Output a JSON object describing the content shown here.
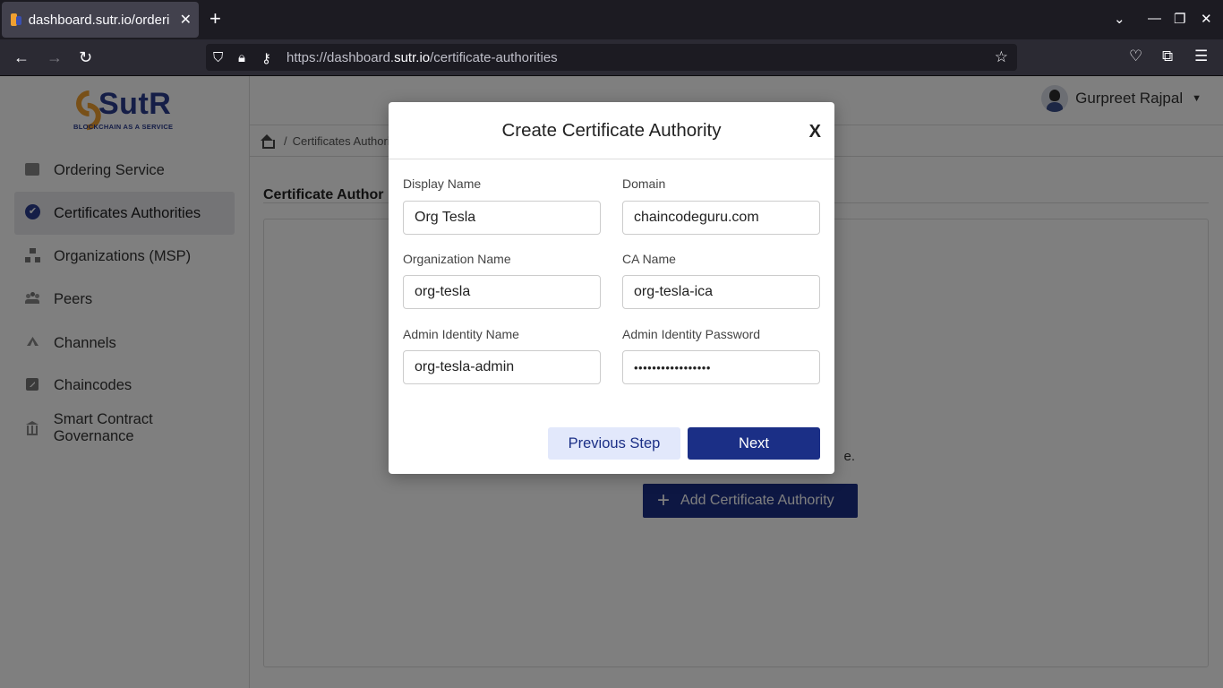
{
  "browser": {
    "tab_title": "dashboard.sutr.io/orderi",
    "tab_close": "✕",
    "new_tab": "+",
    "url_prefix": "https://dashboard.",
    "url_host": "sutr.io",
    "url_path": "/certificate-authorities"
  },
  "sidebar": {
    "logo_text": "SutR",
    "logo_tagline": "BLOCKCHAIN AS A SERVICE",
    "items": [
      {
        "label": "Ordering Service",
        "icon": "box-icon"
      },
      {
        "label": "Certificates Authorities",
        "icon": "verified-icon",
        "active": true
      },
      {
        "label": "Organizations (MSP)",
        "icon": "org-icon"
      },
      {
        "label": "Peers",
        "icon": "peers-icon"
      },
      {
        "label": "Channels",
        "icon": "channels-icon"
      },
      {
        "label": "Chaincodes",
        "icon": "chaincode-icon"
      },
      {
        "label": "Smart Contract Governance",
        "icon": "governance-icon"
      }
    ]
  },
  "header": {
    "user_name": "Gurpreet Rajpal",
    "breadcrumb_sep": "/",
    "breadcrumb_current": "Certificates Authori"
  },
  "main": {
    "page_title": "Certificate Author",
    "empty_text_tail": "e.",
    "add_button_label": "Add Certificate Authority"
  },
  "modal": {
    "title": "Create Certificate Authority",
    "close_label": "X",
    "fields": {
      "display_name": {
        "label": "Display Name",
        "value": "Org Tesla"
      },
      "domain": {
        "label": "Domain",
        "value": "chaincodeguru.com"
      },
      "organization_name": {
        "label": "Organization Name",
        "value": "org-tesla"
      },
      "ca_name": {
        "label": "CA Name",
        "value": "org-tesla-ica"
      },
      "admin_identity_name": {
        "label": "Admin Identity Name",
        "value": "org-tesla-admin"
      },
      "admin_identity_password": {
        "label": "Admin Identity Password",
        "value": "•••••••••••••••••"
      }
    },
    "previous_button": "Previous Step",
    "next_button": "Next"
  },
  "colors": {
    "brand_blue": "#1b2f86",
    "brand_orange": "#f0a030",
    "secondary_button_bg": "#e2e8fb"
  }
}
